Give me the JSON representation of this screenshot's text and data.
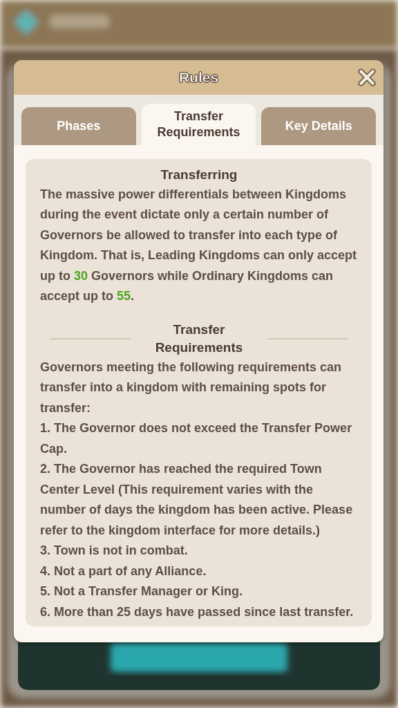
{
  "dialog": {
    "title": "Rules"
  },
  "tabs": [
    {
      "label": "Phases",
      "selected": false
    },
    {
      "label": "Transfer Requirements",
      "selected": true
    },
    {
      "label": "Key Details",
      "selected": false
    }
  ],
  "sections": [
    {
      "heading": "Transferring",
      "divider": false,
      "paragraphs": [
        [
          {
            "text": "The massive power differentials between Kingdoms during the event dictate only a certain number of Governors be allowed to transfer into each type of Kingdom. That is, Leading Kingdoms can only accept up to ",
            "highlight": false
          },
          {
            "text": "30",
            "highlight": true
          },
          {
            "text": " Governors while Ordinary Kingdoms can accept up to ",
            "highlight": false
          },
          {
            "text": "55",
            "highlight": true
          },
          {
            "text": ".",
            "highlight": false
          }
        ]
      ]
    },
    {
      "heading": "Transfer Requirements",
      "divider": true,
      "paragraphs": [
        [
          {
            "text": "Governors meeting the following requirements can transfer into a kingdom with remaining spots for transfer:",
            "highlight": false
          }
        ],
        [
          {
            "text": "1. The Governor does not exceed the Transfer Power Cap.",
            "highlight": false
          }
        ],
        [
          {
            "text": "2. The Governor has reached the required Town Center Level (This requirement varies with the number of days the kingdom has been active. Please refer to the kingdom interface for more details.)",
            "highlight": false
          }
        ],
        [
          {
            "text": "3. Town is not in combat.",
            "highlight": false
          }
        ],
        [
          {
            "text": "4. Not a part of any Alliance.",
            "highlight": false
          }
        ],
        [
          {
            "text": "5. Not a Transfer Manager or King.",
            "highlight": false
          }
        ],
        [
          {
            "text": "6. More than 25 days have passed since last transfer.",
            "highlight": false
          }
        ]
      ]
    }
  ]
}
